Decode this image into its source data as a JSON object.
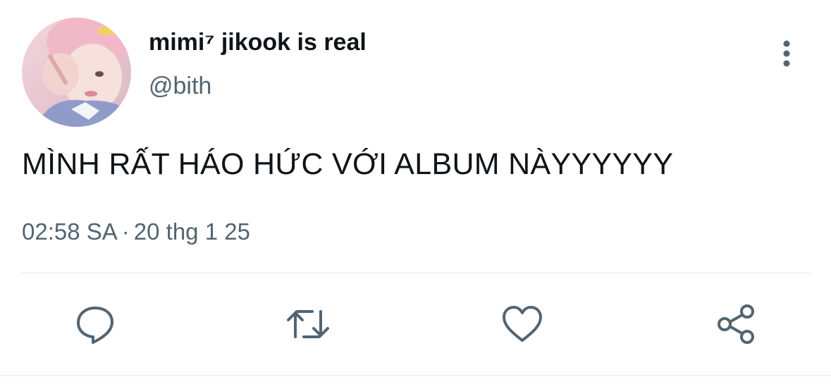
{
  "author": {
    "display_name": "mimi⁷ jikook is real",
    "handle": "@bith",
    "avatar": "profile-photo"
  },
  "tweet": {
    "text": "MÌNH RẤT HÁO HỨC VỚI ALBUM NÀYYYYYY",
    "time": "02:58 SA",
    "separator": "·",
    "date": "20 thg 1 25"
  },
  "actions": {
    "reply_icon": "comment-icon",
    "retweet_icon": "retweet-icon",
    "like_icon": "heart-icon",
    "share_icon": "share-icon",
    "more_icon": "vertical-dots-icon"
  },
  "colors": {
    "text_primary": "#0f1419",
    "text_secondary": "#536471",
    "divider": "#eff3f4",
    "background": "#ffffff"
  }
}
